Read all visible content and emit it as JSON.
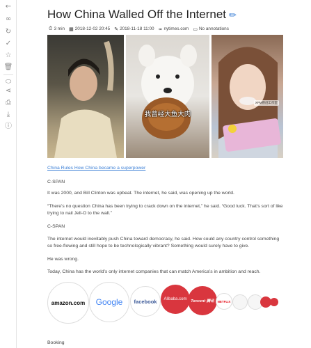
{
  "sidebar": {
    "icons": [
      "back-arrow-icon",
      "link-icon",
      "refresh-icon",
      "check-icon",
      "star-icon",
      "trash-icon",
      "tag-icon",
      "share-icon",
      "print-icon",
      "download-icon",
      "info-icon"
    ]
  },
  "article": {
    "title": "How China Walled Off the Internet",
    "meta": {
      "read_time": "3 min",
      "saved_date": "2018-12-02 20:45",
      "published_date": "2018-11-18 11:00",
      "source": "nytimes.com",
      "annotations": "No annotations"
    },
    "image_caption": "我曾经大鱼大肉",
    "image_watermark": "XPM原创工作室",
    "link_text": "China Rules How China became a superpower",
    "paragraphs": [
      "C-SPAN",
      "It was 2000, and Bill Clinton was upbeat. The internet, he said, was opening up the world.",
      "“There’s no question China has been trying to crack down on the internet,” he said. “Good luck. That’s sort of like trying to nail Jell-O to the wall.”",
      "C-SPAN",
      "The internet would inevitably push China toward democracy, he said. How could any country control something so free-flowing and still hope to be technologically vibrant? Something would surely have to give.",
      "He was wrong.",
      "Today, China has the world’s only internet companies that can match America’s in ambition and reach."
    ],
    "logos": {
      "amazon": "amazon.com",
      "google": "Google",
      "facebook": "facebook",
      "alibaba": "Alibaba.com",
      "tencent": "Tencent 腾讯",
      "netflix": "NETFLIX"
    },
    "footer_text": "Booking"
  },
  "colors": {
    "accent": "#3b7fd6",
    "chinese_red": "#d9363e",
    "facebook_blue": "#3b5998"
  }
}
